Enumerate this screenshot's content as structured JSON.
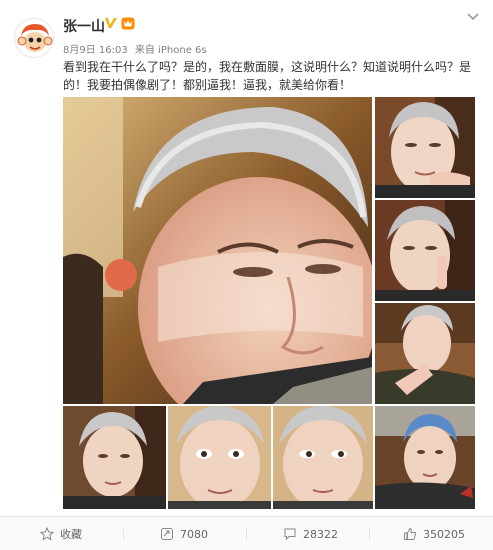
{
  "post": {
    "username": "张一山",
    "timestamp": "8月9日 16:03",
    "source": "来自 iPhone 6s",
    "text": "看到我在干什么了吗？是的，我在敷面膜，这说明什么？知道说明什么吗？是的！我要拍偶像剧了！都别逼我！逼我，就美给你看！"
  },
  "actions": {
    "favorite_label": "收藏",
    "repost_count": "7080",
    "comment_count": "28322",
    "like_count": "350205"
  },
  "icons": {
    "avatar": "monkey-avatar",
    "verified": "verified-badge-icon",
    "vip": "vip-crown-icon",
    "menu": "chevron-down-icon",
    "favorite": "star-icon",
    "repost": "repost-icon",
    "comment": "comment-icon",
    "like": "thumbs-up-icon"
  },
  "colors": {
    "verified_badge": "#f0b400",
    "text": "#333333",
    "meta": "#808080",
    "avatar_accent": "#e8562a"
  }
}
